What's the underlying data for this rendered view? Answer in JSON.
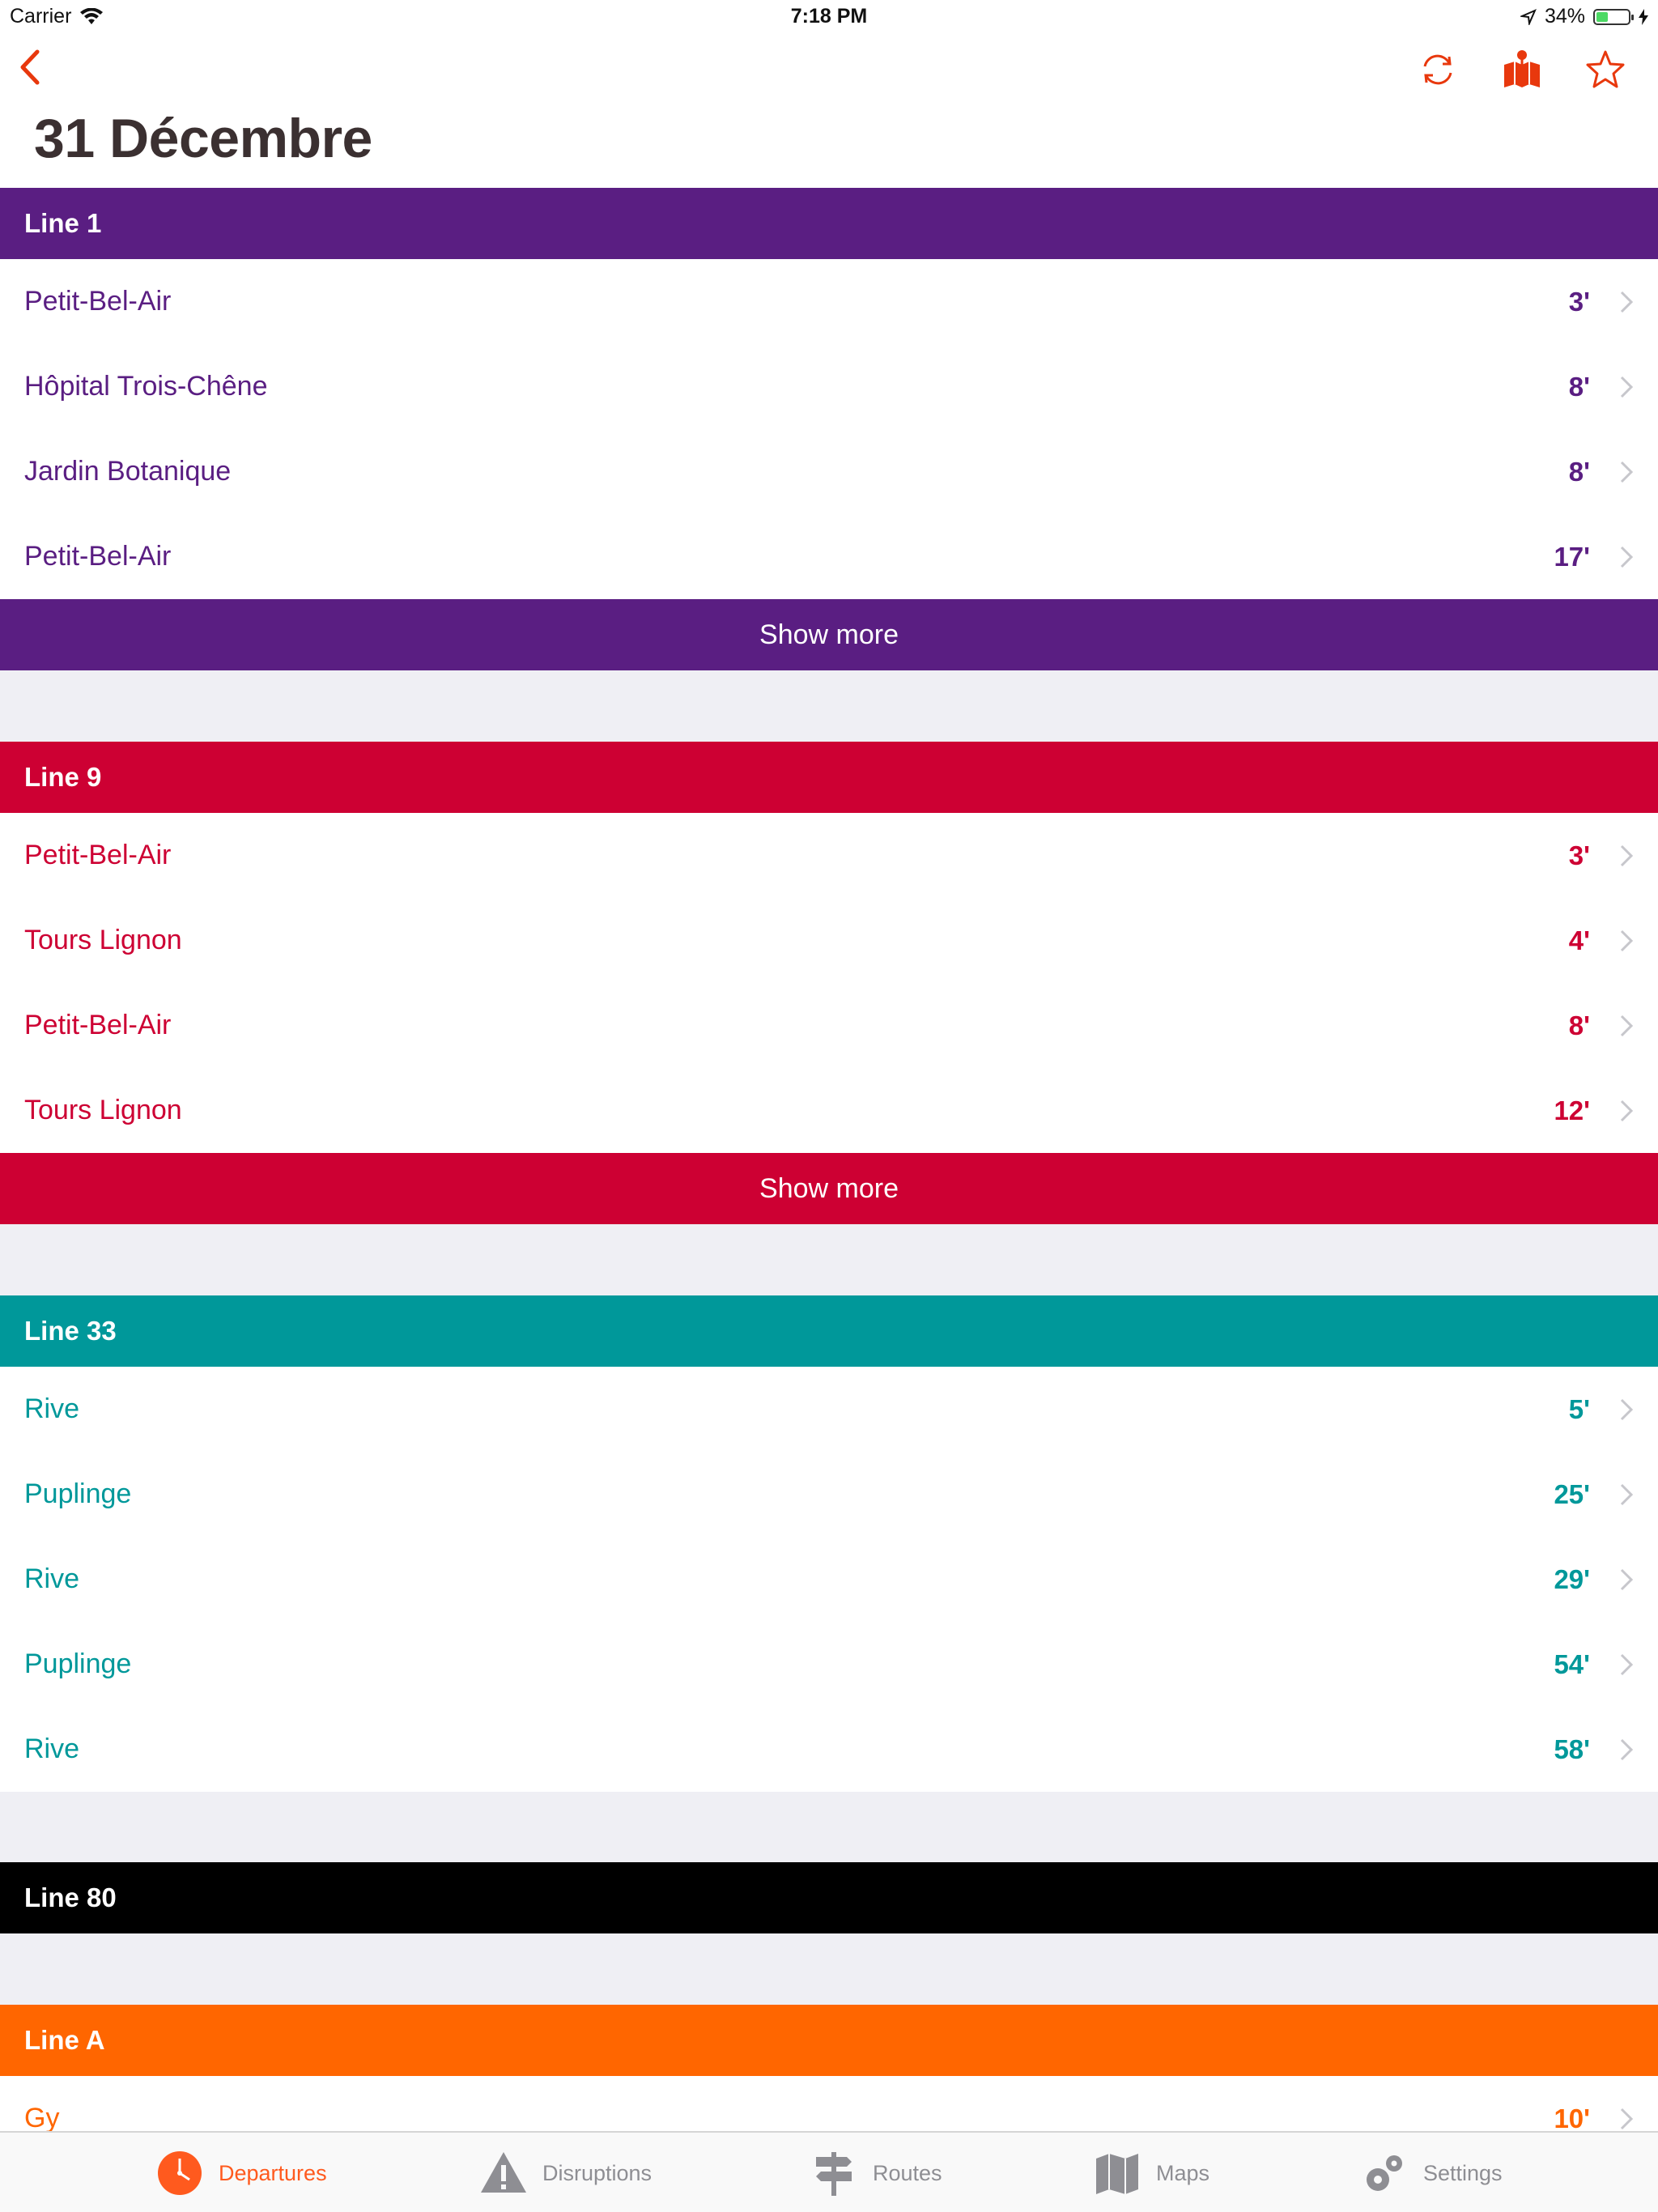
{
  "status_bar": {
    "carrier": "Carrier",
    "time": "7:18 PM",
    "battery": "34%"
  },
  "title": "31 Décembre",
  "colors": {
    "accent": "#e8380d",
    "tab_active": "#ff5a1e",
    "tab_inactive": "#8e8e93"
  },
  "sections": [
    {
      "label": "Line 1",
      "color": "#5a1e82",
      "rows": [
        {
          "dest": "Petit-Bel-Air",
          "mins": "3'"
        },
        {
          "dest": "Hôpital Trois-Chêne",
          "mins": "8'"
        },
        {
          "dest": "Jardin Botanique",
          "mins": "8'"
        },
        {
          "dest": "Petit-Bel-Air",
          "mins": "17'"
        }
      ],
      "show_more": "Show more"
    },
    {
      "label": "Line 9",
      "color": "#cd0033",
      "rows": [
        {
          "dest": "Petit-Bel-Air",
          "mins": "3'"
        },
        {
          "dest": "Tours Lignon",
          "mins": "4'"
        },
        {
          "dest": "Petit-Bel-Air",
          "mins": "8'"
        },
        {
          "dest": "Tours Lignon",
          "mins": "12'"
        }
      ],
      "show_more": "Show more"
    },
    {
      "label": "Line 33",
      "color": "#00989a",
      "rows": [
        {
          "dest": "Rive",
          "mins": "5'"
        },
        {
          "dest": "Puplinge",
          "mins": "25'"
        },
        {
          "dest": "Rive",
          "mins": "29'"
        },
        {
          "dest": "Puplinge",
          "mins": "54'"
        },
        {
          "dest": "Rive",
          "mins": "58'"
        }
      ]
    },
    {
      "label": "Line 80",
      "color": "#000000",
      "rows": []
    },
    {
      "label": "Line A",
      "color": "#ff6600",
      "rows": [
        {
          "dest": "Gy",
          "mins": "10'"
        }
      ]
    }
  ],
  "tabs": [
    {
      "label": "Departures",
      "icon": "clock-icon",
      "active": true
    },
    {
      "label": "Disruptions",
      "icon": "warning-icon",
      "active": false
    },
    {
      "label": "Routes",
      "icon": "signpost-icon",
      "active": false
    },
    {
      "label": "Maps",
      "icon": "map-icon",
      "active": false
    },
    {
      "label": "Settings",
      "icon": "gear-icon",
      "active": false
    }
  ]
}
